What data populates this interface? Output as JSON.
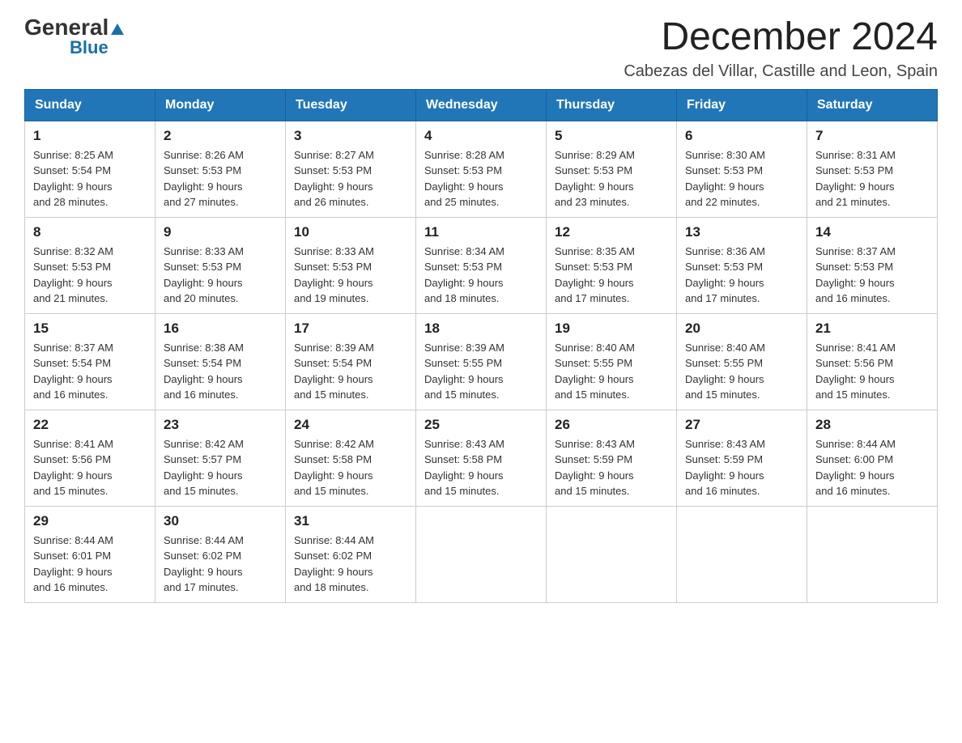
{
  "header": {
    "logo_general": "General",
    "logo_blue": "Blue",
    "month_title": "December 2024",
    "location": "Cabezas del Villar, Castille and Leon, Spain"
  },
  "days_of_week": [
    "Sunday",
    "Monday",
    "Tuesday",
    "Wednesday",
    "Thursday",
    "Friday",
    "Saturday"
  ],
  "weeks": [
    [
      {
        "day": "1",
        "sunrise": "8:25 AM",
        "sunset": "5:54 PM",
        "daylight": "9 hours and 28 minutes."
      },
      {
        "day": "2",
        "sunrise": "8:26 AM",
        "sunset": "5:53 PM",
        "daylight": "9 hours and 27 minutes."
      },
      {
        "day": "3",
        "sunrise": "8:27 AM",
        "sunset": "5:53 PM",
        "daylight": "9 hours and 26 minutes."
      },
      {
        "day": "4",
        "sunrise": "8:28 AM",
        "sunset": "5:53 PM",
        "daylight": "9 hours and 25 minutes."
      },
      {
        "day": "5",
        "sunrise": "8:29 AM",
        "sunset": "5:53 PM",
        "daylight": "9 hours and 23 minutes."
      },
      {
        "day": "6",
        "sunrise": "8:30 AM",
        "sunset": "5:53 PM",
        "daylight": "9 hours and 22 minutes."
      },
      {
        "day": "7",
        "sunrise": "8:31 AM",
        "sunset": "5:53 PM",
        "daylight": "9 hours and 21 minutes."
      }
    ],
    [
      {
        "day": "8",
        "sunrise": "8:32 AM",
        "sunset": "5:53 PM",
        "daylight": "9 hours and 21 minutes."
      },
      {
        "day": "9",
        "sunrise": "8:33 AM",
        "sunset": "5:53 PM",
        "daylight": "9 hours and 20 minutes."
      },
      {
        "day": "10",
        "sunrise": "8:33 AM",
        "sunset": "5:53 PM",
        "daylight": "9 hours and 19 minutes."
      },
      {
        "day": "11",
        "sunrise": "8:34 AM",
        "sunset": "5:53 PM",
        "daylight": "9 hours and 18 minutes."
      },
      {
        "day": "12",
        "sunrise": "8:35 AM",
        "sunset": "5:53 PM",
        "daylight": "9 hours and 17 minutes."
      },
      {
        "day": "13",
        "sunrise": "8:36 AM",
        "sunset": "5:53 PM",
        "daylight": "9 hours and 17 minutes."
      },
      {
        "day": "14",
        "sunrise": "8:37 AM",
        "sunset": "5:53 PM",
        "daylight": "9 hours and 16 minutes."
      }
    ],
    [
      {
        "day": "15",
        "sunrise": "8:37 AM",
        "sunset": "5:54 PM",
        "daylight": "9 hours and 16 minutes."
      },
      {
        "day": "16",
        "sunrise": "8:38 AM",
        "sunset": "5:54 PM",
        "daylight": "9 hours and 16 minutes."
      },
      {
        "day": "17",
        "sunrise": "8:39 AM",
        "sunset": "5:54 PM",
        "daylight": "9 hours and 15 minutes."
      },
      {
        "day": "18",
        "sunrise": "8:39 AM",
        "sunset": "5:55 PM",
        "daylight": "9 hours and 15 minutes."
      },
      {
        "day": "19",
        "sunrise": "8:40 AM",
        "sunset": "5:55 PM",
        "daylight": "9 hours and 15 minutes."
      },
      {
        "day": "20",
        "sunrise": "8:40 AM",
        "sunset": "5:55 PM",
        "daylight": "9 hours and 15 minutes."
      },
      {
        "day": "21",
        "sunrise": "8:41 AM",
        "sunset": "5:56 PM",
        "daylight": "9 hours and 15 minutes."
      }
    ],
    [
      {
        "day": "22",
        "sunrise": "8:41 AM",
        "sunset": "5:56 PM",
        "daylight": "9 hours and 15 minutes."
      },
      {
        "day": "23",
        "sunrise": "8:42 AM",
        "sunset": "5:57 PM",
        "daylight": "9 hours and 15 minutes."
      },
      {
        "day": "24",
        "sunrise": "8:42 AM",
        "sunset": "5:58 PM",
        "daylight": "9 hours and 15 minutes."
      },
      {
        "day": "25",
        "sunrise": "8:43 AM",
        "sunset": "5:58 PM",
        "daylight": "9 hours and 15 minutes."
      },
      {
        "day": "26",
        "sunrise": "8:43 AM",
        "sunset": "5:59 PM",
        "daylight": "9 hours and 15 minutes."
      },
      {
        "day": "27",
        "sunrise": "8:43 AM",
        "sunset": "5:59 PM",
        "daylight": "9 hours and 16 minutes."
      },
      {
        "day": "28",
        "sunrise": "8:44 AM",
        "sunset": "6:00 PM",
        "daylight": "9 hours and 16 minutes."
      }
    ],
    [
      {
        "day": "29",
        "sunrise": "8:44 AM",
        "sunset": "6:01 PM",
        "daylight": "9 hours and 16 minutes."
      },
      {
        "day": "30",
        "sunrise": "8:44 AM",
        "sunset": "6:02 PM",
        "daylight": "9 hours and 17 minutes."
      },
      {
        "day": "31",
        "sunrise": "8:44 AM",
        "sunset": "6:02 PM",
        "daylight": "9 hours and 18 minutes."
      },
      null,
      null,
      null,
      null
    ]
  ]
}
